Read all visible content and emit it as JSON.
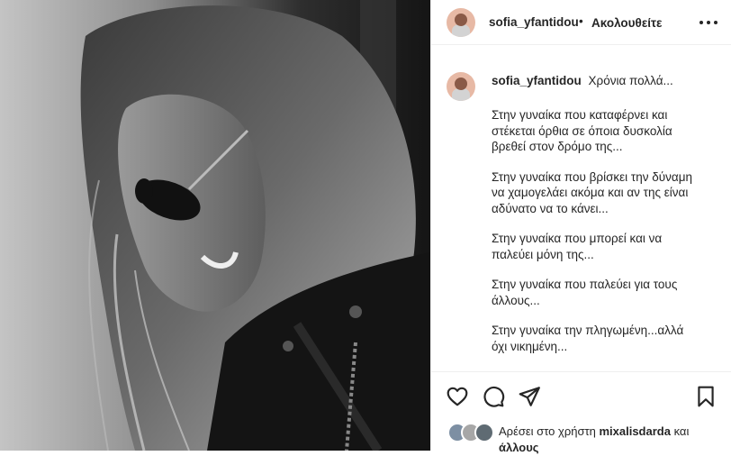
{
  "post": {
    "username": "sofia_yfantidou",
    "separator": "•",
    "follow_status": "Ακολουθείτε"
  },
  "caption": {
    "username": "sofia_yfantidou",
    "first_line": "Χρόνια πολλά...",
    "paragraphs": [
      "Στην γυναίκα που καταφέρνει και στέκεται όρθια σε όποια δυσκολία βρεθεί στον δρόμο της...",
      "Στην γυναίκα που βρίσκει την δύναμη να χαμογελάει ακόμα και αν της είναι αδύνατο να το κάνει...",
      "Στην γυναίκα που μπορεί και να παλεύει μόνη της...",
      "Στην γυναίκα που παλεύει για τους άλλους...",
      "Στην γυναίκα την πληγωμένη...αλλά όχι νικημένη..."
    ]
  },
  "actions": {
    "like_icon": "heart-icon",
    "comment_icon": "comment-icon",
    "share_icon": "paper-plane-icon",
    "save_icon": "bookmark-icon"
  },
  "likes": {
    "prefix": "Αρέσει στο χρήστη",
    "user": "mixalisdarda",
    "middle": "και",
    "suffix": "άλλους"
  },
  "colors": {
    "text": "#262626",
    "divider": "#efefef"
  }
}
